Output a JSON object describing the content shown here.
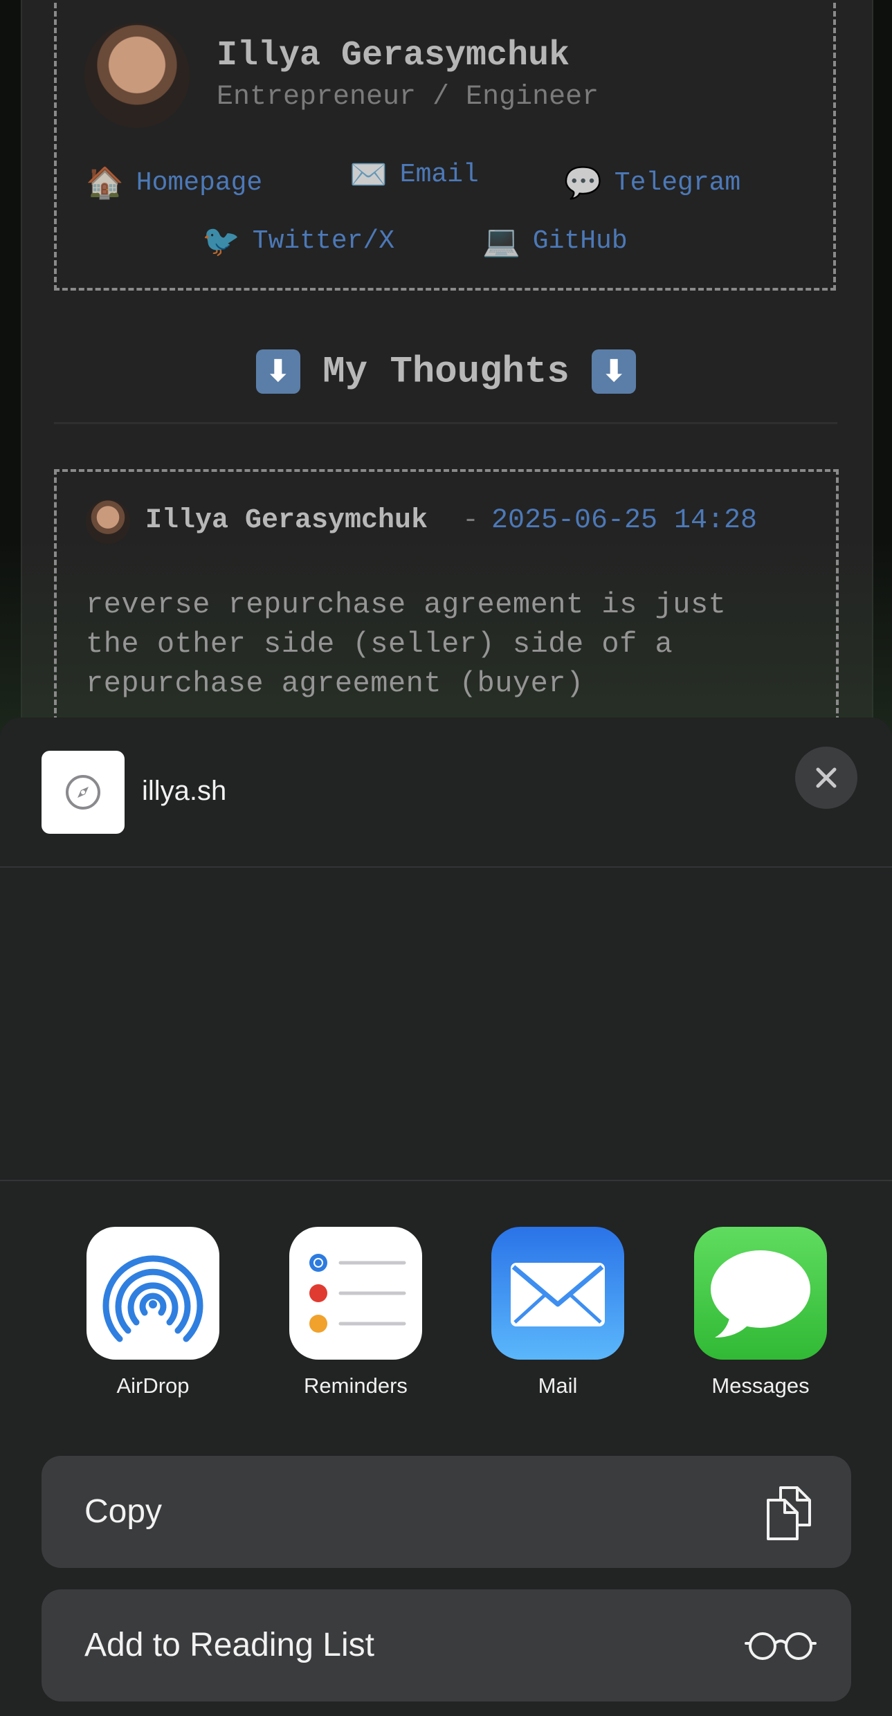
{
  "webpage": {
    "profile": {
      "name": "Illya Gerasymchuk",
      "role": "Entrepreneur / Engineer",
      "links": [
        {
          "icon": "🏠",
          "label": "Homepage"
        },
        {
          "icon": "✉️",
          "label": "Email"
        },
        {
          "icon": "💬",
          "label": "Telegram"
        },
        {
          "icon": "🐦",
          "label": "Twitter/X"
        },
        {
          "icon": "💻",
          "label": "GitHub"
        }
      ]
    },
    "section_title": "My Thoughts",
    "section_arrow": "⬇",
    "post": {
      "author": "Illya Gerasymchuk",
      "separator": "-",
      "date": "2025-06-25 14:28",
      "body": "reverse repurchase agreement is just\nthe other side (seller) side of a\nrepurchase agreement (buyer)"
    }
  },
  "share_sheet": {
    "site_title": "illya.sh",
    "apps": [
      {
        "label": "AirDrop",
        "icon": "airdrop-icon"
      },
      {
        "label": "Reminders",
        "icon": "reminders-icon"
      },
      {
        "label": "Mail",
        "icon": "mail-icon"
      },
      {
        "label": "Messages",
        "icon": "messages-icon"
      }
    ],
    "actions": [
      {
        "label": "Copy",
        "icon": "copy-icon"
      },
      {
        "label": "Add to Reading List",
        "icon": "glasses-icon"
      }
    ]
  },
  "colors": {
    "link": "#4c79b8",
    "sheet_bg": "#222323",
    "action_bg": "#3b3c3e"
  }
}
